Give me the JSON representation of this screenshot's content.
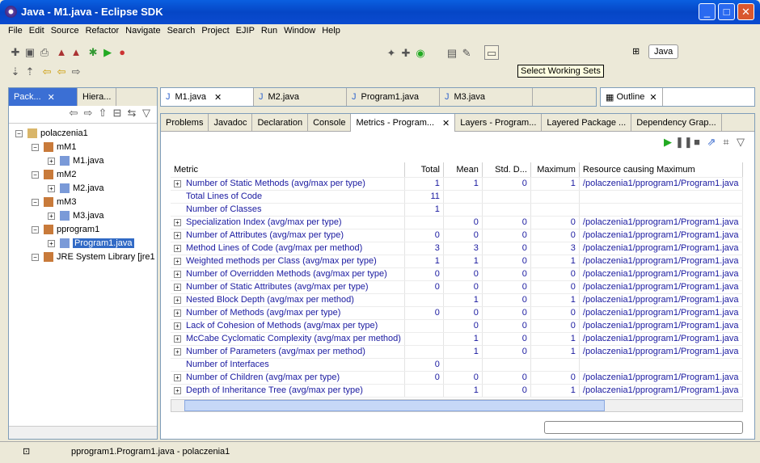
{
  "window": {
    "title": "Java - M1.java - Eclipse SDK"
  },
  "menu": [
    "File",
    "Edit",
    "Source",
    "Refactor",
    "Navigate",
    "Search",
    "Project",
    "EJIP",
    "Run",
    "Window",
    "Help"
  ],
  "tooltip": "Select Working Sets",
  "perspective": "Java",
  "left_tabs": [
    "Pack...",
    "Hiera..."
  ],
  "tree": [
    {
      "label": "polaczenia1",
      "level": 0
    },
    {
      "label": "mM1",
      "level": 1
    },
    {
      "label": "M1.java",
      "level": 2
    },
    {
      "label": "mM2",
      "level": 1
    },
    {
      "label": "M2.java",
      "level": 2
    },
    {
      "label": "mM3",
      "level": 1
    },
    {
      "label": "M3.java",
      "level": 2
    },
    {
      "label": "pprogram1",
      "level": 1
    },
    {
      "label": "Program1.java",
      "level": 2,
      "selected": true
    },
    {
      "label": "JRE System Library [jre1",
      "level": 1
    }
  ],
  "editor_tabs": [
    "M1.java",
    "M2.java",
    "Program1.java",
    "M3.java"
  ],
  "outline_tab": "Outline",
  "view_tabs": [
    "Problems",
    "Javadoc",
    "Declaration",
    "Console",
    "Metrics - Program...",
    "Layers - Program...",
    "Layered Package ...",
    "Dependency Grap..."
  ],
  "metrics": {
    "columns": [
      "Metric",
      "Total",
      "Mean",
      "Std. D...",
      "Maximum",
      "Resource causing Maximum"
    ],
    "rows": [
      {
        "expand": true,
        "metric": "Number of Static Methods (avg/max per type)",
        "total": "1",
        "mean": "1",
        "std": "0",
        "max": "1",
        "res": "/polaczenia1/pprogram1/Program1.java"
      },
      {
        "expand": false,
        "metric": "Total Lines of Code",
        "total": "11",
        "mean": "",
        "std": "",
        "max": "",
        "res": ""
      },
      {
        "expand": false,
        "metric": "Number of Classes",
        "total": "1",
        "mean": "",
        "std": "",
        "max": "",
        "res": ""
      },
      {
        "expand": true,
        "metric": "Specialization Index (avg/max per type)",
        "total": "",
        "mean": "0",
        "std": "0",
        "max": "0",
        "res": "/polaczenia1/pprogram1/Program1.java"
      },
      {
        "expand": true,
        "metric": "Number of Attributes (avg/max per type)",
        "total": "0",
        "mean": "0",
        "std": "0",
        "max": "0",
        "res": "/polaczenia1/pprogram1/Program1.java"
      },
      {
        "expand": true,
        "metric": "Method Lines of Code (avg/max per method)",
        "total": "3",
        "mean": "3",
        "std": "0",
        "max": "3",
        "res": "/polaczenia1/pprogram1/Program1.java"
      },
      {
        "expand": true,
        "metric": "Weighted methods per Class (avg/max per type)",
        "total": "1",
        "mean": "1",
        "std": "0",
        "max": "1",
        "res": "/polaczenia1/pprogram1/Program1.java"
      },
      {
        "expand": true,
        "metric": "Number of Overridden Methods (avg/max per type)",
        "total": "0",
        "mean": "0",
        "std": "0",
        "max": "0",
        "res": "/polaczenia1/pprogram1/Program1.java"
      },
      {
        "expand": true,
        "metric": "Number of Static Attributes (avg/max per type)",
        "total": "0",
        "mean": "0",
        "std": "0",
        "max": "0",
        "res": "/polaczenia1/pprogram1/Program1.java"
      },
      {
        "expand": true,
        "metric": "Nested Block Depth (avg/max per method)",
        "total": "",
        "mean": "1",
        "std": "0",
        "max": "1",
        "res": "/polaczenia1/pprogram1/Program1.java"
      },
      {
        "expand": true,
        "metric": "Number of Methods (avg/max per type)",
        "total": "0",
        "mean": "0",
        "std": "0",
        "max": "0",
        "res": "/polaczenia1/pprogram1/Program1.java"
      },
      {
        "expand": true,
        "metric": "Lack of Cohesion of Methods (avg/max per type)",
        "total": "",
        "mean": "0",
        "std": "0",
        "max": "0",
        "res": "/polaczenia1/pprogram1/Program1.java"
      },
      {
        "expand": true,
        "metric": "McCabe Cyclomatic Complexity (avg/max per method)",
        "total": "",
        "mean": "1",
        "std": "0",
        "max": "1",
        "res": "/polaczenia1/pprogram1/Program1.java"
      },
      {
        "expand": true,
        "metric": "Number of Parameters (avg/max per method)",
        "total": "",
        "mean": "1",
        "std": "0",
        "max": "1",
        "res": "/polaczenia1/pprogram1/Program1.java"
      },
      {
        "expand": false,
        "metric": "Number of Interfaces",
        "total": "0",
        "mean": "",
        "std": "",
        "max": "",
        "res": ""
      },
      {
        "expand": true,
        "metric": "Number of Children (avg/max per type)",
        "total": "0",
        "mean": "0",
        "std": "0",
        "max": "0",
        "res": "/polaczenia1/pprogram1/Program1.java"
      },
      {
        "expand": true,
        "metric": "Depth of Inheritance Tree (avg/max per type)",
        "total": "",
        "mean": "1",
        "std": "0",
        "max": "1",
        "res": "/polaczenia1/pprogram1/Program1.java"
      }
    ]
  },
  "status": {
    "text": "pprogram1.Program1.java - polaczenia1"
  }
}
